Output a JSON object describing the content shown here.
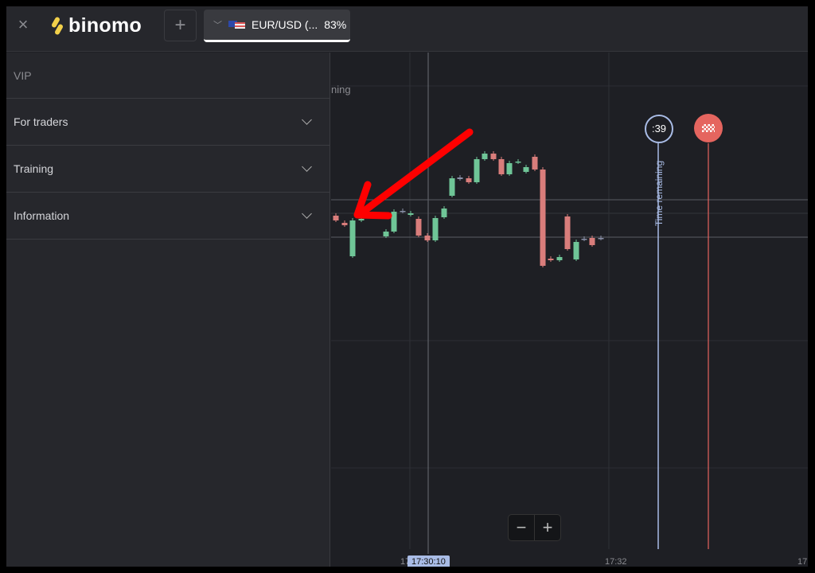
{
  "header": {
    "close_icon": "close-icon",
    "logo_text": "binomo",
    "add_label": "+",
    "asset": {
      "name": "EUR/USD (...",
      "payout": "83%",
      "flag": "eu-us-flag-icon"
    }
  },
  "sidebar": {
    "items": [
      {
        "label": "VIP"
      },
      {
        "label": "For traders"
      },
      {
        "label": "Training"
      },
      {
        "label": "Information"
      }
    ]
  },
  "chart": {
    "partial_label": "ning",
    "timer": ":39",
    "timer_label": "Time remaining",
    "time_labels": [
      "17:",
      "17:32",
      "17:"
    ],
    "cursor_time": "17:30:10",
    "zoom_out": "−",
    "zoom_in": "+",
    "colors": {
      "up": "#6fc597",
      "down": "#d97d7b",
      "neutral": "#8a90a8",
      "timer": "#a9bce6",
      "finish": "#e5655f",
      "annotation_arrow": "#ff0000"
    }
  }
}
